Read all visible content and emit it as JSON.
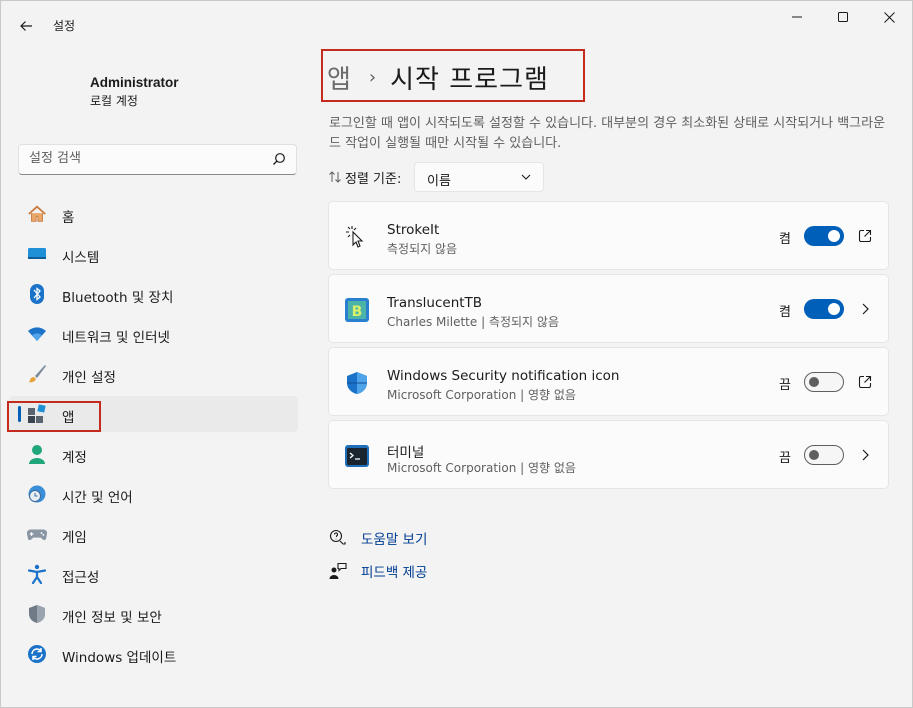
{
  "window": {
    "title": "설정"
  },
  "profile": {
    "name": "Administrator",
    "account_type": "로컬 계정"
  },
  "search": {
    "placeholder": "설정 검색"
  },
  "nav": {
    "items": [
      {
        "label": "홈",
        "icon": "home-icon"
      },
      {
        "label": "시스템",
        "icon": "system-icon"
      },
      {
        "label": "Bluetooth 및 장치",
        "icon": "bluetooth-icon"
      },
      {
        "label": "네트워크 및 인터넷",
        "icon": "wifi-icon"
      },
      {
        "label": "개인 설정",
        "icon": "paintbrush-icon"
      },
      {
        "label": "앱",
        "icon": "apps-icon",
        "selected": true
      },
      {
        "label": "계정",
        "icon": "person-icon"
      },
      {
        "label": "시간 및 언어",
        "icon": "globe-clock-icon"
      },
      {
        "label": "게임",
        "icon": "gamepad-icon"
      },
      {
        "label": "접근성",
        "icon": "accessibility-icon"
      },
      {
        "label": "개인 정보 및 보안",
        "icon": "shield-icon"
      },
      {
        "label": "Windows 업데이트",
        "icon": "update-icon"
      }
    ]
  },
  "breadcrumb": {
    "parent": "앱",
    "separator": "›",
    "current": "시작 프로그램"
  },
  "description": "로그인할 때 앱이 시작되도록 설정할 수 있습니다. 대부분의 경우 최소화된 상태로 시작되거나 백그라운드 작업이 실행될 때만 시작될 수 있습니다.",
  "sort": {
    "label": "정렬 기준:",
    "value": "이름"
  },
  "startup_apps": [
    {
      "name": "StrokeIt",
      "subtitle": "측정되지 않음",
      "state": "켬",
      "on": true,
      "action": "open-external-icon",
      "icon": "strokeit-icon"
    },
    {
      "name": "TranslucentTB",
      "subtitle": "Charles Milette  |  측정되지 않음",
      "state": "켬",
      "on": true,
      "action": "chevron-right-icon",
      "icon": "translucenttb-icon"
    },
    {
      "name": "Windows Security notification icon",
      "subtitle": "Microsoft Corporation  |  영향 없음",
      "state": "끔",
      "on": false,
      "action": "open-external-icon",
      "icon": "windows-security-icon"
    },
    {
      "name": "터미널",
      "subtitle": "Microsoft Corporation  |  영향 없음",
      "state": "끔",
      "on": false,
      "action": "chevron-right-icon",
      "icon": "terminal-icon"
    }
  ],
  "links": {
    "help": "도움말 보기",
    "feedback": "피드백 제공"
  },
  "colors": {
    "accent": "#005fb8",
    "highlight_box": "#c42b1c",
    "link": "#003e92"
  }
}
